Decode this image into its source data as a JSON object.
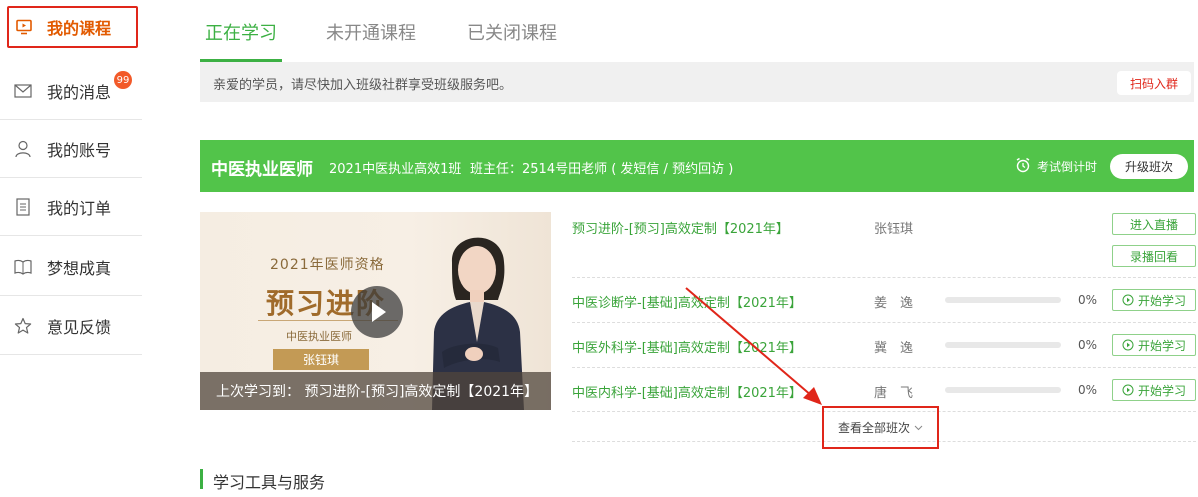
{
  "sidebar": {
    "items": [
      {
        "label": "我的课程",
        "icon": "video-course-icon"
      },
      {
        "label": "我的消息",
        "icon": "mail-icon",
        "badge": "99"
      },
      {
        "label": "我的账号",
        "icon": "user-icon"
      },
      {
        "label": "我的订单",
        "icon": "order-document-icon"
      },
      {
        "label": "梦想成真",
        "icon": "book-icon"
      },
      {
        "label": "意见反馈",
        "icon": "star-icon"
      }
    ]
  },
  "tabs": [
    {
      "label": "正在学习",
      "active": true
    },
    {
      "label": "未开通课程",
      "active": false
    },
    {
      "label": "已关闭课程",
      "active": false
    }
  ],
  "notice": {
    "text": "亲爱的学员，请尽快加入班级社群享受班级服务吧。",
    "button": "扫码入群"
  },
  "class_header": {
    "title": "中医执业医师",
    "class_name": "2021中医执业高效1班",
    "teacher": "班主任：2514号田老师 ( 发短信 / 预约回访 )",
    "countdown": "考试倒计时",
    "upgrade": "升级班次"
  },
  "video": {
    "year_text": "2021年医师资格",
    "big_text": "预习进阶",
    "subtitle": "中医执业医师",
    "name": "张钰琪",
    "last_study": "上次学习到： 预习进阶-[预习]高效定制【2021年】"
  },
  "courses": [
    {
      "name": "预习进阶-[预习]高效定制【2021年】",
      "teacher": "张钰琪",
      "buttons": [
        "进入直播",
        "录播回看"
      ]
    },
    {
      "name": "中医诊断学-[基础]高效定制【2021年】",
      "teacher": "姜　逸",
      "progress": "0%",
      "progress_value": 0,
      "button": "开始学习"
    },
    {
      "name": "中医外科学-[基础]高效定制【2021年】",
      "teacher": "冀　逸",
      "progress": "0%",
      "progress_value": 0,
      "button": "开始学习"
    },
    {
      "name": "中医内科学-[基础]高效定制【2021年】",
      "teacher": "唐　飞",
      "progress": "0%",
      "progress_value": 0,
      "button": "开始学习"
    }
  ],
  "view_all": "查看全部班次",
  "tools_title": "学习工具与服务",
  "colors": {
    "accent": "#3cb043",
    "header_green": "#52c44a",
    "highlight_red": "#e0261a",
    "active_orange": "#e25a00"
  }
}
